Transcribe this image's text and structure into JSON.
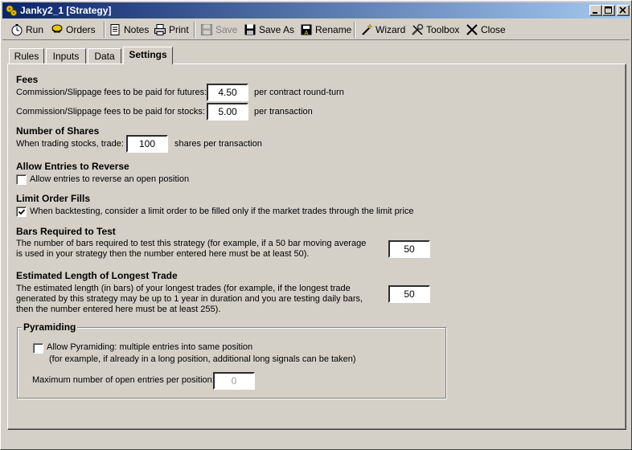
{
  "window": {
    "title": "Janky2_1  [Strategy]"
  },
  "toolbar": {
    "run": "Run",
    "orders": "Orders",
    "notes": "Notes",
    "print": "Print",
    "save": "Save",
    "save_as": "Save As",
    "rename": "Rename",
    "wizard": "Wizard",
    "toolbox": "Toolbox",
    "close": "Close"
  },
  "tabs": [
    {
      "label": "Rules"
    },
    {
      "label": "Inputs"
    },
    {
      "label": "Data"
    },
    {
      "label": "Settings",
      "active": true
    }
  ],
  "fees": {
    "heading": "Fees",
    "futures_label": "Commission/Slippage fees to be paid for futures:",
    "futures_value": "4.50",
    "futures_unit": "per contract round-turn",
    "stocks_label": "Commission/Slippage fees to be paid for stocks:",
    "stocks_value": "5.00",
    "stocks_unit": "per transaction"
  },
  "shares": {
    "heading": "Number of Shares",
    "label": "When trading stocks, trade:",
    "value": "100",
    "unit": "shares per transaction"
  },
  "reverse": {
    "heading": "Allow Entries to Reverse",
    "checkbox_label": "Allow entries to reverse an open position",
    "checked": false
  },
  "limit": {
    "heading": "Limit Order Fills",
    "checkbox_label": "When backtesting, consider a limit order to be filled only if the market trades through the limit price",
    "checked": true
  },
  "bars": {
    "heading": "Bars Required to Test",
    "line1": "The number of bars required to test this strategy  (for example, if a 50 bar moving average",
    "line2": "is used in your strategy then the number entered here must be at least 50).",
    "value": "50"
  },
  "longest": {
    "heading": "Estimated Length of Longest Trade",
    "line1": "The estimated length (in bars) of your longest trades  (for example, if the longest trade",
    "line2": "generated by this strategy may be up to 1 year in duration and you are testing daily bars,",
    "line3": "then the number entered here must be at least 255).",
    "value": "50"
  },
  "pyramiding": {
    "title": "Pyramiding",
    "checkbox_label": "Allow Pyramiding:  multiple entries into same position",
    "note": "(for example, if already in a long position, additional long signals can be taken)",
    "checked": false,
    "max_label": "Maximum number of open entries per position:",
    "max_value": "0"
  },
  "colors": {
    "titlebar_start": "#0a246a",
    "titlebar_end": "#a6caf0",
    "face": "#d4d0c8"
  }
}
